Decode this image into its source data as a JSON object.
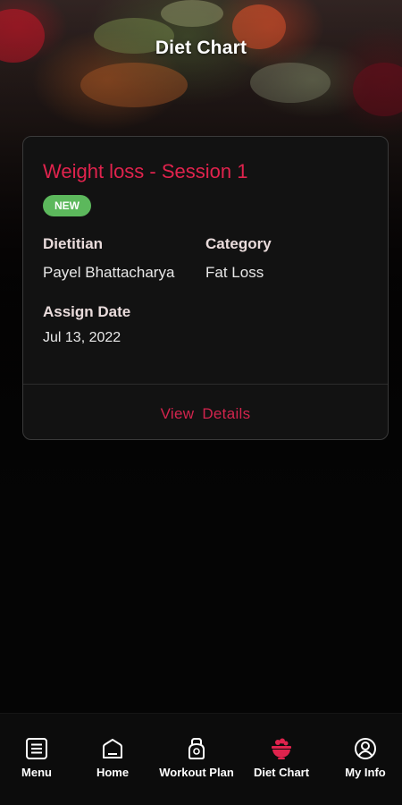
{
  "header": {
    "title": "Diet Chart"
  },
  "card": {
    "title": "Weight loss - Session 1",
    "badge": "NEW",
    "dietitian_label": "Dietitian",
    "dietitian_value": "Payel Bhattacharya",
    "category_label": "Category",
    "category_value": "Fat Loss",
    "assign_date_label": "Assign Date",
    "assign_date_value": "Jul 13, 2022",
    "view_details": "View  Details"
  },
  "nav": {
    "items": [
      {
        "label": "Menu",
        "icon": "menu-icon"
      },
      {
        "label": "Home",
        "icon": "home-icon"
      },
      {
        "label": "Workout Plan",
        "icon": "kettlebell-icon"
      },
      {
        "label": "Diet Chart",
        "icon": "food-bowl-icon",
        "active": true
      },
      {
        "label": "My Info",
        "icon": "user-circle-icon"
      }
    ]
  },
  "colors": {
    "accent": "#e0234d",
    "badge": "#5cb85c",
    "card_bg": "#121212",
    "background": "#050505"
  }
}
